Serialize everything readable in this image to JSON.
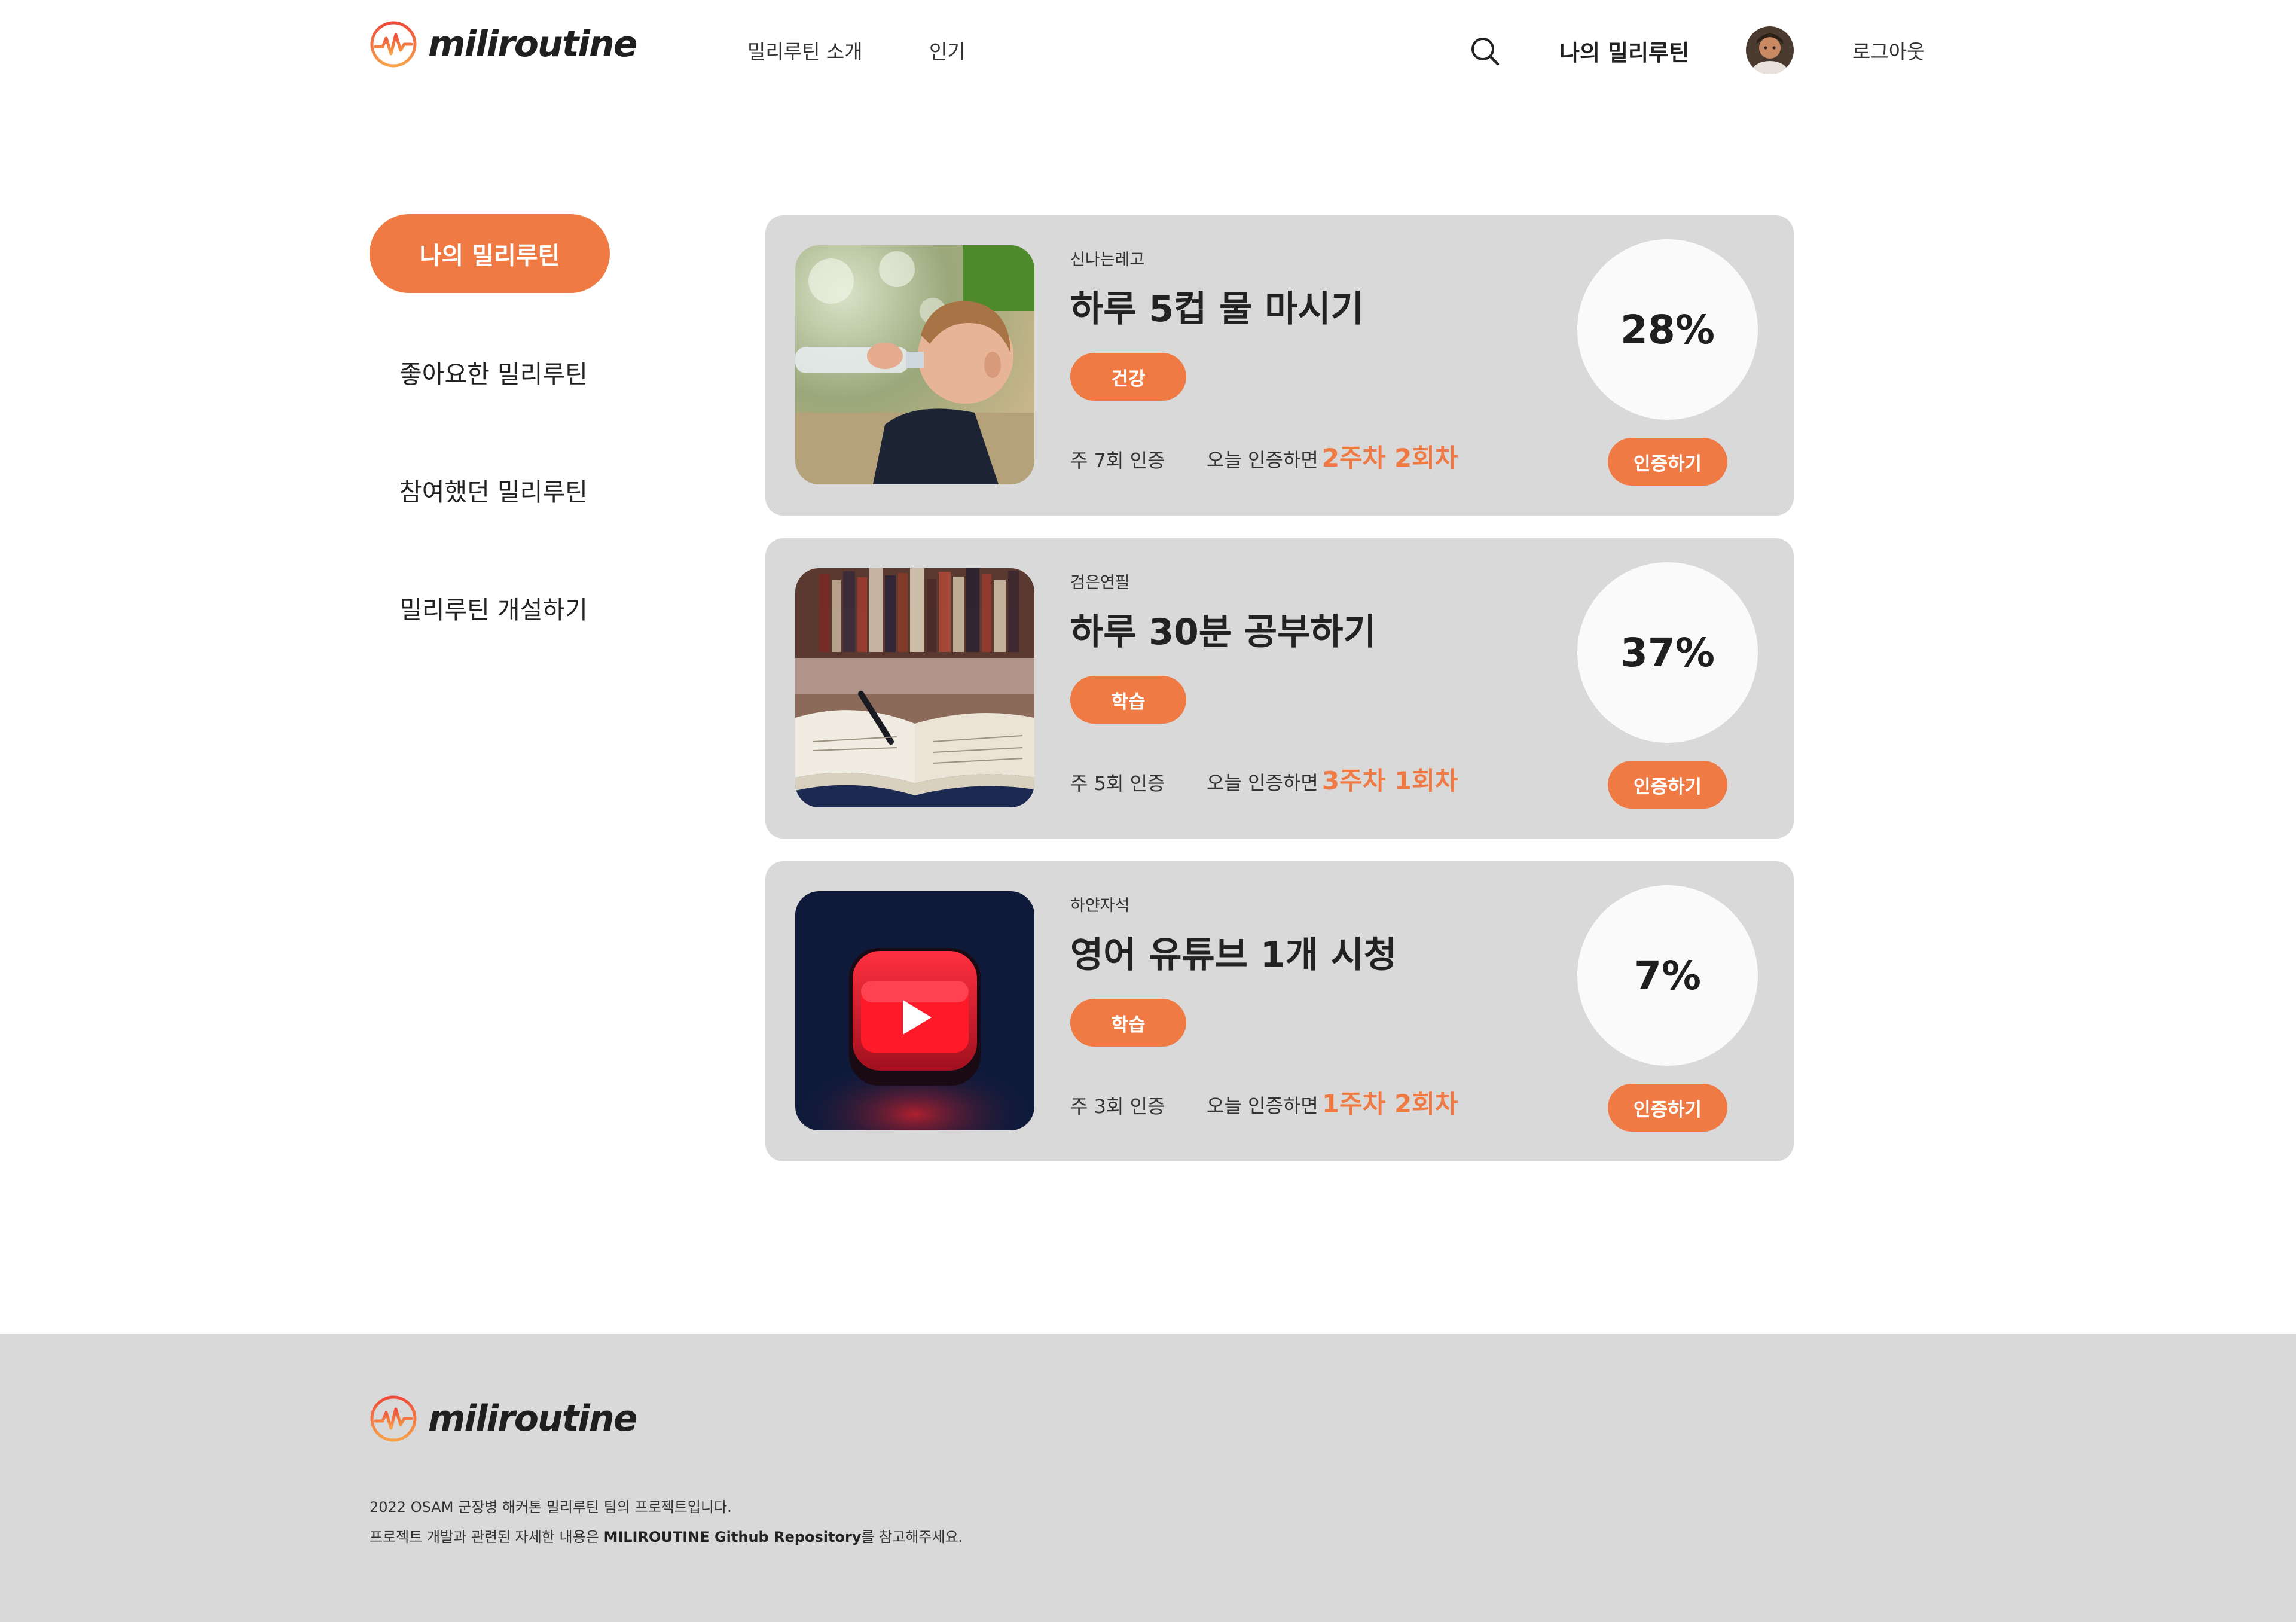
{
  "brand": {
    "name": "miliroutine",
    "accent_color": "#f07a44",
    "logo_icon": "heartbeat-circle-icon"
  },
  "header": {
    "nav": [
      "밀리루틴 소개",
      "인기"
    ],
    "search_icon": "search-icon",
    "my_routine": "나의 밀리루틴",
    "avatar_icon": "avatar",
    "logout": "로그아웃"
  },
  "sidebar": {
    "items": [
      {
        "label": "나의 밀리루틴",
        "active": true
      },
      {
        "label": "좋아요한 밀리루틴",
        "active": false
      },
      {
        "label": "참여했던 밀리루틴",
        "active": false
      },
      {
        "label": "밀리루틴 개설하기",
        "active": false
      }
    ]
  },
  "routines": [
    {
      "owner": "신나는레고",
      "title": "하루 5컵 물 마시기",
      "category": "건강",
      "frequency": "주 7회 인증",
      "today_prefix": "오늘 인증하면",
      "today_highlight": "2주차 2회차",
      "progress": "28%",
      "certify_label": "인증하기",
      "image": "child-drinking-water-image"
    },
    {
      "owner": "검은연필",
      "title": "하루 30분 공부하기",
      "category": "학습",
      "frequency": "주 5회 인증",
      "today_prefix": "오늘 인증하면",
      "today_highlight": "3주차 1회차",
      "progress": "37%",
      "certify_label": "인증하기",
      "image": "open-book-image"
    },
    {
      "owner": "하얀자석",
      "title": "영어 유튜브 1개 시청",
      "category": "학습",
      "frequency": "주 3회 인증",
      "today_prefix": "오늘 인증하면",
      "today_highlight": "1주차 2회차",
      "progress": "7%",
      "certify_label": "인증하기",
      "image": "youtube-logo-image"
    }
  ],
  "footer": {
    "brand": "miliroutine",
    "line1": "2022 OSAM 군장병 해커톤 밀리루틴 팀의 프로젝트입니다.",
    "line2_prefix": "프로젝트 개발과 관련된 자세한 내용은 ",
    "line2_link": "MILIROUTINE Github Repository",
    "line2_suffix": "를 참고해주세요."
  }
}
